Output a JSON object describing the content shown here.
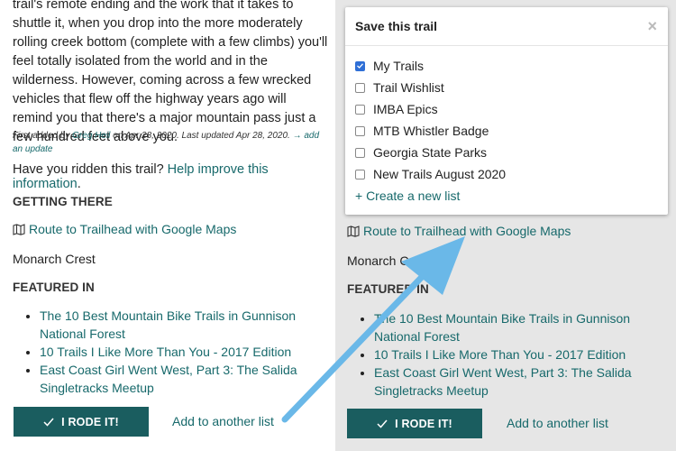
{
  "description_text": "trail's remote ending and the work that it takes to shuttle it, when you drop into the more moderately rolling creek bottom (complete with a few climbs) you'll feel totally isolated from the world and in the wilderness. However, coming across a few wrecked vehicles that flew off the highway years ago will remind you that there's a major mountain pass just a few hundred feet above you.",
  "attribution": {
    "prefix": "First added by ",
    "author": "Greg Heil",
    "middle": " on Apr 28, 2020. Last updated Apr 28, 2020. ",
    "add_update": "→ add an update"
  },
  "ridden": {
    "question": "Have you ridden this trail? ",
    "link": "Help improve this information",
    "suffix": "."
  },
  "getting_there": {
    "heading": "GETTING THERE",
    "route_link": "Route to Trailhead with Google Maps",
    "location": "Monarch Crest"
  },
  "featured": {
    "heading": "FEATURED IN",
    "items": [
      "The 10 Best Mountain Bike Trails in Gunnison National Forest",
      "10 Trails I Like More Than You - 2017 Edition",
      "East Coast Girl Went West, Part 3: The Salida Singletracks Meetup"
    ]
  },
  "actions": {
    "rode_button": "I RODE IT!",
    "add_list": "Add to another list"
  },
  "modal": {
    "title": "Save this trail",
    "close": "×",
    "lists": [
      {
        "label": "My Trails",
        "checked": true
      },
      {
        "label": "Trail Wishlist",
        "checked": false
      },
      {
        "label": "IMBA Epics",
        "checked": false
      },
      {
        "label": "MTB Whistler Badge",
        "checked": false
      },
      {
        "label": "Georgia State Parks",
        "checked": false
      },
      {
        "label": "New Trails August 2020",
        "checked": false
      }
    ],
    "create_new": "+ Create a new list"
  },
  "right_panel": {
    "route_link": "Route to Trailhead with Google Maps",
    "location": "Monarch Crest",
    "featured_heading": "FEATURED IN",
    "items": [
      "The 10 Best Mountain Bike Trails in Gunnison National Forest",
      "10 Trails I Like More Than You - 2017 Edition",
      "East Coast Girl Went West, Part 3: The Salida Singletracks Meetup"
    ],
    "rode_button": "I RODE IT!",
    "add_list": "Add to another list"
  },
  "colors": {
    "link": "#17696b",
    "button": "#1a5d5f",
    "arrow": "#6ab8e8"
  }
}
